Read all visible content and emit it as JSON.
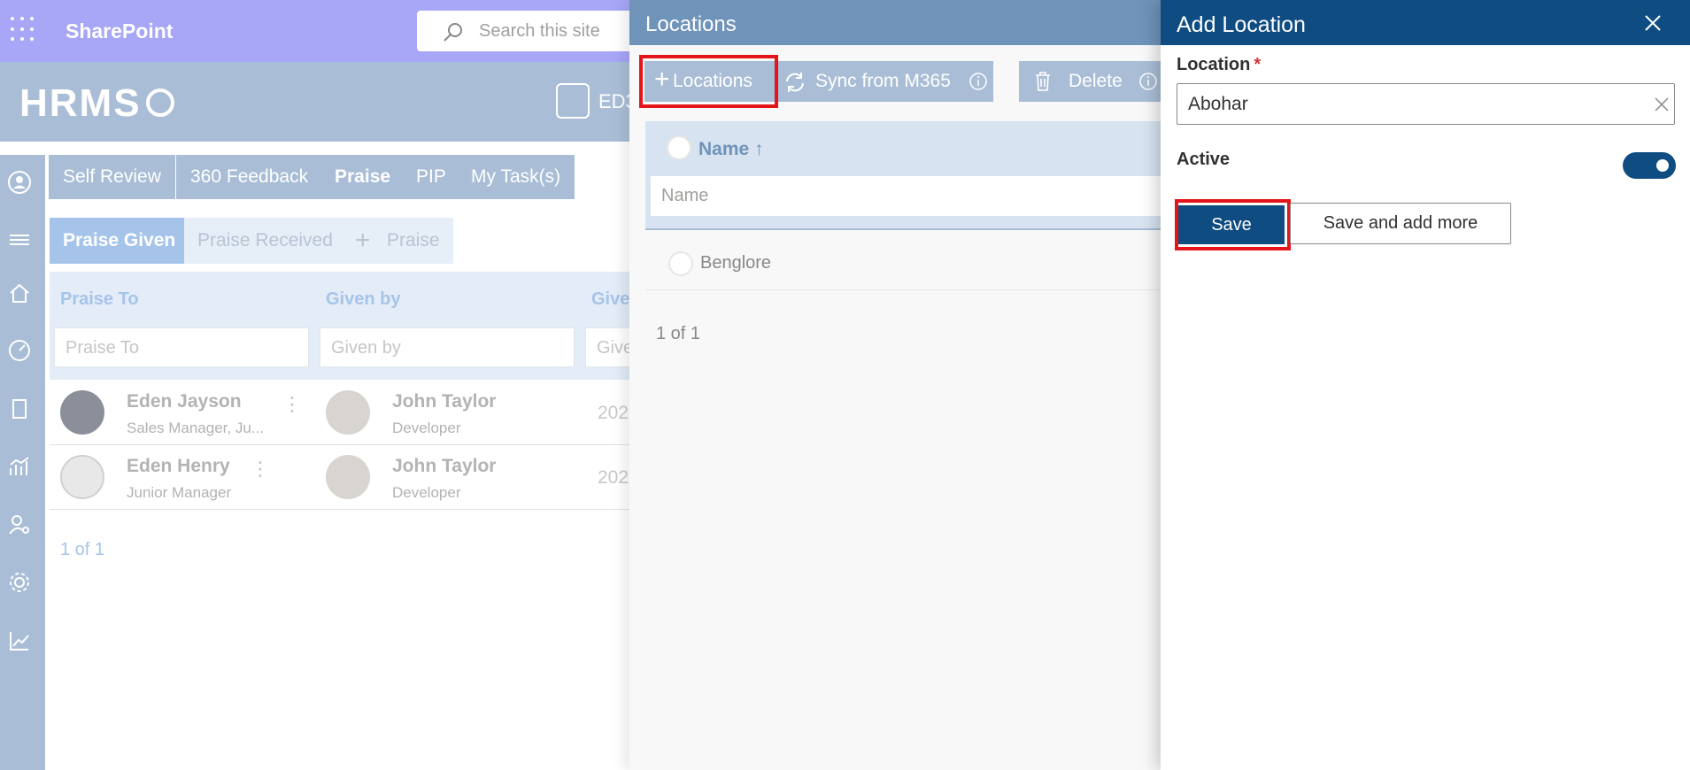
{
  "sharepoint": {
    "brand": "SharePoint",
    "search_placeholder": "Search this site"
  },
  "hrms": {
    "logo": "HRMS",
    "user_short": "ED3"
  },
  "tabs": [
    {
      "label": "Self Review"
    },
    {
      "label": "360 Feedback"
    },
    {
      "label": "Praise"
    },
    {
      "label": "PIP"
    },
    {
      "label": "My Task(s)"
    }
  ],
  "subtabs": {
    "given": "Praise Given",
    "received": "Praise Received",
    "add": "Praise"
  },
  "praise_grid": {
    "columns": [
      "Praise To",
      "Given by",
      "Give"
    ],
    "filters": [
      "Praise To",
      "Given by",
      "Give"
    ],
    "rows": [
      {
        "to_name": "Eden Jayson",
        "to_sub": "Sales Manager, Ju...",
        "by_name": "John Taylor",
        "by_sub": "Developer",
        "date": "202"
      },
      {
        "to_name": "Eden Henry",
        "to_sub": "Junior Manager",
        "by_name": "John Taylor",
        "by_sub": "Developer",
        "date": "202"
      }
    ],
    "pager": "1 of 1"
  },
  "locations_panel": {
    "title": "Locations",
    "add_button": "Locations",
    "sync_button": "Sync from M365",
    "delete_button": "Delete",
    "column_name": "Name ↑",
    "filter_placeholder": "Name",
    "rows": [
      "Benglore"
    ],
    "pager": "1 of 1"
  },
  "add_location": {
    "title": "Add Location",
    "location_label": "Location",
    "required_mark": "*",
    "location_value": "Abohar",
    "active_label": "Active",
    "active_on": true,
    "save_label": "Save",
    "save_more_label": "Save and add more"
  },
  "colors": {
    "primary": "#0f4c81",
    "highlight": "#e3151a",
    "suite_bar": "#a7a6f7"
  }
}
